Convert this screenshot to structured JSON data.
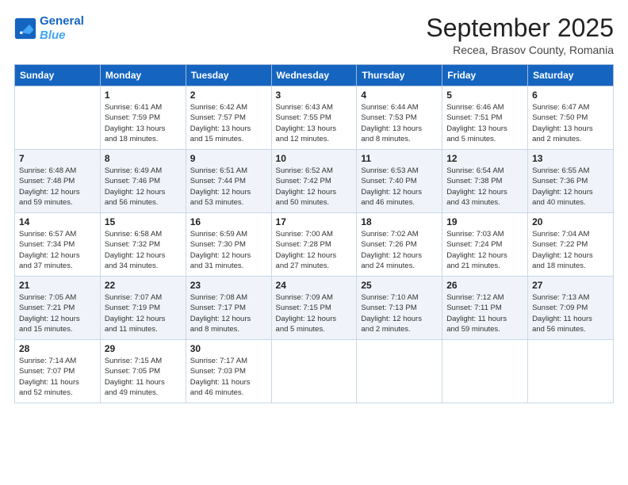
{
  "header": {
    "logo_line1": "General",
    "logo_line2": "Blue",
    "month": "September 2025",
    "location": "Recea, Brasov County, Romania"
  },
  "weekdays": [
    "Sunday",
    "Monday",
    "Tuesday",
    "Wednesday",
    "Thursday",
    "Friday",
    "Saturday"
  ],
  "weeks": [
    [
      {
        "day": "",
        "text": ""
      },
      {
        "day": "1",
        "text": "Sunrise: 6:41 AM\nSunset: 7:59 PM\nDaylight: 13 hours\nand 18 minutes."
      },
      {
        "day": "2",
        "text": "Sunrise: 6:42 AM\nSunset: 7:57 PM\nDaylight: 13 hours\nand 15 minutes."
      },
      {
        "day": "3",
        "text": "Sunrise: 6:43 AM\nSunset: 7:55 PM\nDaylight: 13 hours\nand 12 minutes."
      },
      {
        "day": "4",
        "text": "Sunrise: 6:44 AM\nSunset: 7:53 PM\nDaylight: 13 hours\nand 8 minutes."
      },
      {
        "day": "5",
        "text": "Sunrise: 6:46 AM\nSunset: 7:51 PM\nDaylight: 13 hours\nand 5 minutes."
      },
      {
        "day": "6",
        "text": "Sunrise: 6:47 AM\nSunset: 7:50 PM\nDaylight: 13 hours\nand 2 minutes."
      }
    ],
    [
      {
        "day": "7",
        "text": "Sunrise: 6:48 AM\nSunset: 7:48 PM\nDaylight: 12 hours\nand 59 minutes."
      },
      {
        "day": "8",
        "text": "Sunrise: 6:49 AM\nSunset: 7:46 PM\nDaylight: 12 hours\nand 56 minutes."
      },
      {
        "day": "9",
        "text": "Sunrise: 6:51 AM\nSunset: 7:44 PM\nDaylight: 12 hours\nand 53 minutes."
      },
      {
        "day": "10",
        "text": "Sunrise: 6:52 AM\nSunset: 7:42 PM\nDaylight: 12 hours\nand 50 minutes."
      },
      {
        "day": "11",
        "text": "Sunrise: 6:53 AM\nSunset: 7:40 PM\nDaylight: 12 hours\nand 46 minutes."
      },
      {
        "day": "12",
        "text": "Sunrise: 6:54 AM\nSunset: 7:38 PM\nDaylight: 12 hours\nand 43 minutes."
      },
      {
        "day": "13",
        "text": "Sunrise: 6:55 AM\nSunset: 7:36 PM\nDaylight: 12 hours\nand 40 minutes."
      }
    ],
    [
      {
        "day": "14",
        "text": "Sunrise: 6:57 AM\nSunset: 7:34 PM\nDaylight: 12 hours\nand 37 minutes."
      },
      {
        "day": "15",
        "text": "Sunrise: 6:58 AM\nSunset: 7:32 PM\nDaylight: 12 hours\nand 34 minutes."
      },
      {
        "day": "16",
        "text": "Sunrise: 6:59 AM\nSunset: 7:30 PM\nDaylight: 12 hours\nand 31 minutes."
      },
      {
        "day": "17",
        "text": "Sunrise: 7:00 AM\nSunset: 7:28 PM\nDaylight: 12 hours\nand 27 minutes."
      },
      {
        "day": "18",
        "text": "Sunrise: 7:02 AM\nSunset: 7:26 PM\nDaylight: 12 hours\nand 24 minutes."
      },
      {
        "day": "19",
        "text": "Sunrise: 7:03 AM\nSunset: 7:24 PM\nDaylight: 12 hours\nand 21 minutes."
      },
      {
        "day": "20",
        "text": "Sunrise: 7:04 AM\nSunset: 7:22 PM\nDaylight: 12 hours\nand 18 minutes."
      }
    ],
    [
      {
        "day": "21",
        "text": "Sunrise: 7:05 AM\nSunset: 7:21 PM\nDaylight: 12 hours\nand 15 minutes."
      },
      {
        "day": "22",
        "text": "Sunrise: 7:07 AM\nSunset: 7:19 PM\nDaylight: 12 hours\nand 11 minutes."
      },
      {
        "day": "23",
        "text": "Sunrise: 7:08 AM\nSunset: 7:17 PM\nDaylight: 12 hours\nand 8 minutes."
      },
      {
        "day": "24",
        "text": "Sunrise: 7:09 AM\nSunset: 7:15 PM\nDaylight: 12 hours\nand 5 minutes."
      },
      {
        "day": "25",
        "text": "Sunrise: 7:10 AM\nSunset: 7:13 PM\nDaylight: 12 hours\nand 2 minutes."
      },
      {
        "day": "26",
        "text": "Sunrise: 7:12 AM\nSunset: 7:11 PM\nDaylight: 11 hours\nand 59 minutes."
      },
      {
        "day": "27",
        "text": "Sunrise: 7:13 AM\nSunset: 7:09 PM\nDaylight: 11 hours\nand 56 minutes."
      }
    ],
    [
      {
        "day": "28",
        "text": "Sunrise: 7:14 AM\nSunset: 7:07 PM\nDaylight: 11 hours\nand 52 minutes."
      },
      {
        "day": "29",
        "text": "Sunrise: 7:15 AM\nSunset: 7:05 PM\nDaylight: 11 hours\nand 49 minutes."
      },
      {
        "day": "30",
        "text": "Sunrise: 7:17 AM\nSunset: 7:03 PM\nDaylight: 11 hours\nand 46 minutes."
      },
      {
        "day": "",
        "text": ""
      },
      {
        "day": "",
        "text": ""
      },
      {
        "day": "",
        "text": ""
      },
      {
        "day": "",
        "text": ""
      }
    ]
  ]
}
